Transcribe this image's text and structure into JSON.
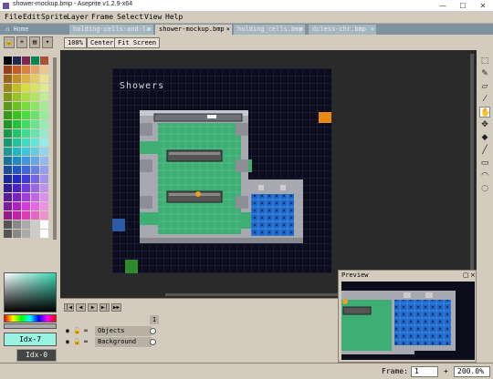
{
  "window": {
    "title": "shower-mockup.bmp - Aseprite v1.2.9-x64",
    "minimize": "—",
    "maximize": "☐",
    "close": "✕"
  },
  "menu": [
    "File",
    "Edit",
    "Sprite",
    "Layer",
    "Frame",
    "Select",
    "View",
    "Help"
  ],
  "tabs": {
    "home": "Home",
    "items": [
      {
        "label": "holding-cells-and-la",
        "close": "×",
        "active": false
      },
      {
        "label": "shower-mockup.bmp",
        "close": "×",
        "active": true
      },
      {
        "label": "holding_cells.bmp",
        "close": "×",
        "active": false
      },
      {
        "label": "dcless-chr.bmp",
        "close": "×",
        "active": false
      }
    ]
  },
  "context_bar": {
    "zoom": "100%",
    "center": "Center",
    "fit": "Fit Screen"
  },
  "color_panel": {
    "fg_label": "Idx-7",
    "bg_label": "Idx-0",
    "fg_color": "#9af2e0"
  },
  "canvas": {
    "sprite_title": "Showers"
  },
  "timeline": {
    "frame_number": "1",
    "layers": [
      {
        "name": "Objects"
      },
      {
        "name": "Background"
      }
    ]
  },
  "preview": {
    "title": "Preview"
  },
  "status": {
    "frame_label": "Frame:",
    "frame_value": "1",
    "zoom_value": "200.0%",
    "plus": "+"
  },
  "colors": {
    "ui_bg": "#d3cbbe",
    "tab_bar": "#7d929e",
    "floor": "#3fae74",
    "tile": "#1d67c9",
    "wall": "#a8a8b0"
  }
}
